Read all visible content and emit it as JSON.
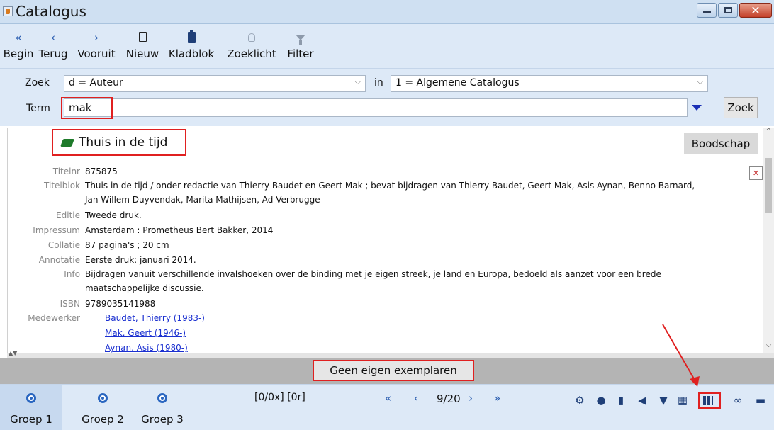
{
  "window": {
    "title": "Catalogus",
    "close_symbol": "✕"
  },
  "toolbar": {
    "items": [
      {
        "label": "Begin",
        "icon": "double-chevron-left-icon",
        "glyph": "«"
      },
      {
        "label": "Terug",
        "icon": "chevron-left-icon",
        "glyph": "‹"
      },
      {
        "label": "Vooruit",
        "icon": "chevron-right-icon",
        "glyph": "›"
      },
      {
        "label": "Nieuw",
        "icon": "new-document-icon"
      },
      {
        "label": "Kladblok",
        "icon": "clipboard-icon"
      },
      {
        "label": "Zoeklicht",
        "icon": "lightbulb-icon"
      },
      {
        "label": "Filter",
        "icon": "filter-icon"
      }
    ]
  },
  "search": {
    "zoek_label": "Zoek",
    "field_value": "d = Auteur",
    "in_label": "in",
    "catalog_value": "1 = Algemene Catalogus",
    "term_label": "Term",
    "term_value": "mak",
    "button_label": "Zoek"
  },
  "record": {
    "title": "Thuis in de tijd",
    "boodschap_label": "Boodschap",
    "close_symbol": "✕",
    "fields": [
      {
        "label": "Titelnr",
        "lines": [
          "875875"
        ]
      },
      {
        "label": "Titelblok",
        "lines": [
          "Thuis in de tijd / onder redactie van Thierry Baudet en Geert Mak ; bevat bijdragen van Thierry Baudet, Geert Mak, Asis Aynan, Benno Barnard,",
          "Jan Willem Duyvendak, Marita Mathijsen, Ad Verbrugge"
        ]
      },
      {
        "label": "Editie",
        "lines": [
          "Tweede druk."
        ]
      },
      {
        "label": "Impressum",
        "lines": [
          "Amsterdam : Prometheus Bert Bakker, 2014"
        ]
      },
      {
        "label": "Collatie",
        "lines": [
          "87 pagina's ; 20 cm"
        ]
      },
      {
        "label": "Annotatie",
        "lines": [
          "Eerste druk: januari 2014."
        ]
      },
      {
        "label": "Info",
        "lines": [
          "Bijdragen vanuit verschillende invalshoeken over de binding met je eigen streek, je land en Europa, bedoeld als aanzet voor een brede",
          "maatschappelijke discussie."
        ]
      },
      {
        "label": "ISBN",
        "lines": [
          "9789035141988"
        ]
      }
    ],
    "medewerker_label": "Medewerker",
    "medewerkers": [
      "Baudet, Thierry (1983-)",
      "Mak, Geert (1946-)",
      "Aynan, Asis (1980-)"
    ]
  },
  "status": {
    "message": "Geen eigen exemplaren"
  },
  "bottom": {
    "groups": [
      "Groep 1",
      "Groep 2",
      "Groep 3"
    ],
    "counters": "[0/0x] [0r]",
    "first": "«",
    "prev": "‹",
    "page_position": "9/20",
    "next": "›",
    "last": "»",
    "tools": [
      "settings-icon",
      "globe-icon",
      "clipboard-icon",
      "megaphone-icon",
      "basket-icon",
      "calendar-icon",
      "barcode-icon",
      "link-icon",
      "print-icon"
    ]
  },
  "colors": {
    "highlight": "#e02020",
    "accent": "#2a5db0",
    "link": "#1a2fd0"
  }
}
